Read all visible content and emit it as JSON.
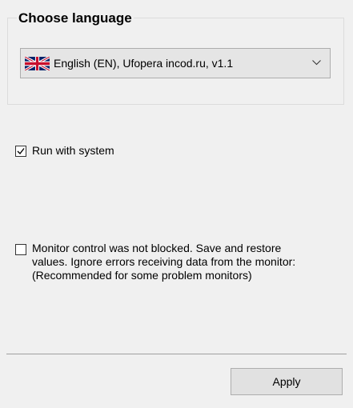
{
  "language_group": {
    "title": "Choose language",
    "selected_language": "English (EN), Ufopera incod.ru, v1.1",
    "flag_icon": "uk-flag-icon",
    "dropdown_icon": "chevron-down-icon"
  },
  "options": {
    "run_with_system": {
      "label": "Run with system",
      "checked": true
    },
    "monitor_control": {
      "label_lines": [
        "Monitor control was not blocked. Save and restore",
        "values. Ignore errors receiving data from the monitor:",
        "(Recommended for some problem monitors)"
      ],
      "checked": false
    }
  },
  "footer": {
    "apply_label": "Apply"
  },
  "colors": {
    "window_background": "#f0f0f0",
    "combo_background": "#e5e5e5",
    "button_background": "#e1e1e1",
    "border": "#adadad"
  }
}
